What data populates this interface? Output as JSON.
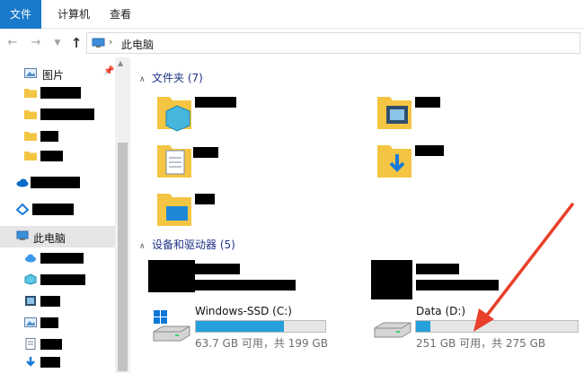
{
  "ribbon": {
    "tabs": [
      "文件",
      "计算机",
      "查看"
    ]
  },
  "address": {
    "path_label": "此电脑"
  },
  "sidebar": {
    "items": [
      {
        "label": "图片",
        "icon": "pictures-icon"
      },
      {
        "label": "",
        "icon": "folder-icon"
      },
      {
        "label": "",
        "icon": "folder-icon"
      },
      {
        "label": "",
        "icon": "folder-icon"
      },
      {
        "label": "",
        "icon": "folder-icon"
      },
      {
        "label": "",
        "icon": "onedrive-icon"
      },
      {
        "label": "",
        "icon": "network-share-icon"
      },
      {
        "label": "此电脑",
        "icon": "this-pc-icon"
      },
      {
        "label": "",
        "icon": "cloud-icon"
      },
      {
        "label": "",
        "icon": "3d-objects-icon"
      },
      {
        "label": "",
        "icon": "videos-icon"
      },
      {
        "label": "",
        "icon": "pictures-icon"
      },
      {
        "label": "",
        "icon": "documents-icon"
      },
      {
        "label": "",
        "icon": "downloads-icon"
      }
    ]
  },
  "folders_group": {
    "title": "文件夹 (7)"
  },
  "devices_group": {
    "title": "设备和驱动器 (5)",
    "drives": [
      {
        "name": "Windows-SSD (C:)",
        "free_text": "63.7 GB 可用，共 199 GB",
        "used_fraction": 0.68
      },
      {
        "name": "Data (D:)",
        "free_text": "251 GB 可用，共 275 GB",
        "used_fraction": 0.09
      }
    ]
  },
  "colors": {
    "accent": "#1979ca",
    "drive_bar": "#26a0da",
    "arrow": "#e8402a"
  }
}
